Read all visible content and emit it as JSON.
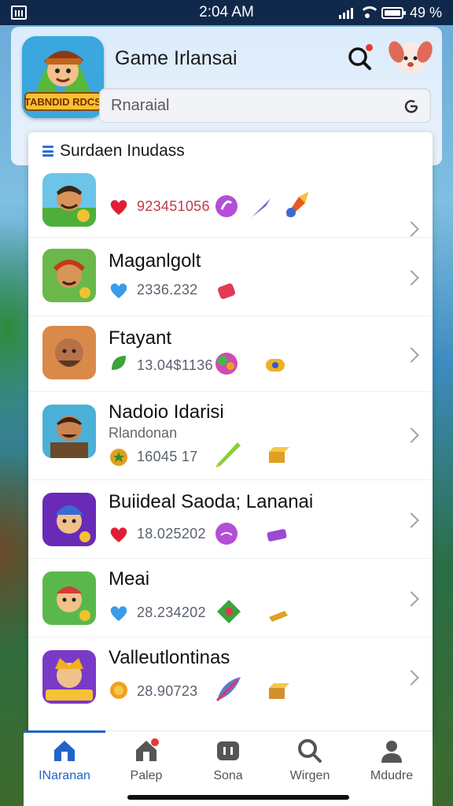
{
  "status_bar": {
    "time": "2:04 AM",
    "battery": "49 %"
  },
  "header": {
    "title": "Game Irlansai",
    "app_icon_text": "TABNDID RDCS",
    "search_placeholder": "Rnaraial",
    "notification_count": ""
  },
  "list": {
    "section_title": "Surdaen Inudass",
    "rows": [
      {
        "name": "",
        "sub": "",
        "value": "923451056",
        "stat_icon": "heart-icon",
        "stat_color": "#e21d35",
        "items": [
          "purple-orb-icon",
          "purple-arrow-icon",
          "rocket-icon"
        ]
      },
      {
        "name": "Maganlgolt",
        "sub": "",
        "value": "2336.232",
        "stat_icon": "heart-icon",
        "stat_color": "#3a9be6",
        "items": [
          "red-gem-icon"
        ]
      },
      {
        "name": "Ftayant",
        "sub": "",
        "value": "13.04$1136",
        "stat_icon": "leaf-icon",
        "stat_color": "#3aa53a",
        "items": [
          "colorful-orb-icon",
          "bead-icon"
        ]
      },
      {
        "name": "Nadoio Idarisi",
        "sub": "Rlandonan",
        "value": "16045 17",
        "stat_icon": "star-badge-icon",
        "stat_color": "#e0a020",
        "items": [
          "green-pencil-icon",
          "gold-box-icon"
        ]
      },
      {
        "name": "Buiideal Saoda; Lananai",
        "sub": "",
        "value": "18.025202",
        "stat_icon": "heart-icon",
        "stat_color": "#e21d35",
        "items": [
          "purple-orb-icon",
          "purple-bar-icon"
        ]
      },
      {
        "name": "Meai",
        "sub": "",
        "value": "28.234202",
        "stat_icon": "heart-icon",
        "stat_color": "#3a9be6",
        "items": [
          "green-gem-icon",
          "gold-bar-icon"
        ]
      },
      {
        "name": "Valleutlontinas",
        "sub": "",
        "value": "28.90723",
        "stat_icon": "coin-icon",
        "stat_color": "#f0a020",
        "items": [
          "feather-icon",
          "gold-box-icon"
        ]
      }
    ]
  },
  "nav": [
    {
      "label": "INaranan",
      "icon": "home-icon",
      "active": true
    },
    {
      "label": "Palep",
      "icon": "house-alert-icon",
      "active": false
    },
    {
      "label": "Sona",
      "icon": "gamepad-icon",
      "active": false
    },
    {
      "label": "Wirgen",
      "icon": "search-icon",
      "active": false
    },
    {
      "label": "Mdudre",
      "icon": "profile-icon",
      "active": false
    }
  ]
}
